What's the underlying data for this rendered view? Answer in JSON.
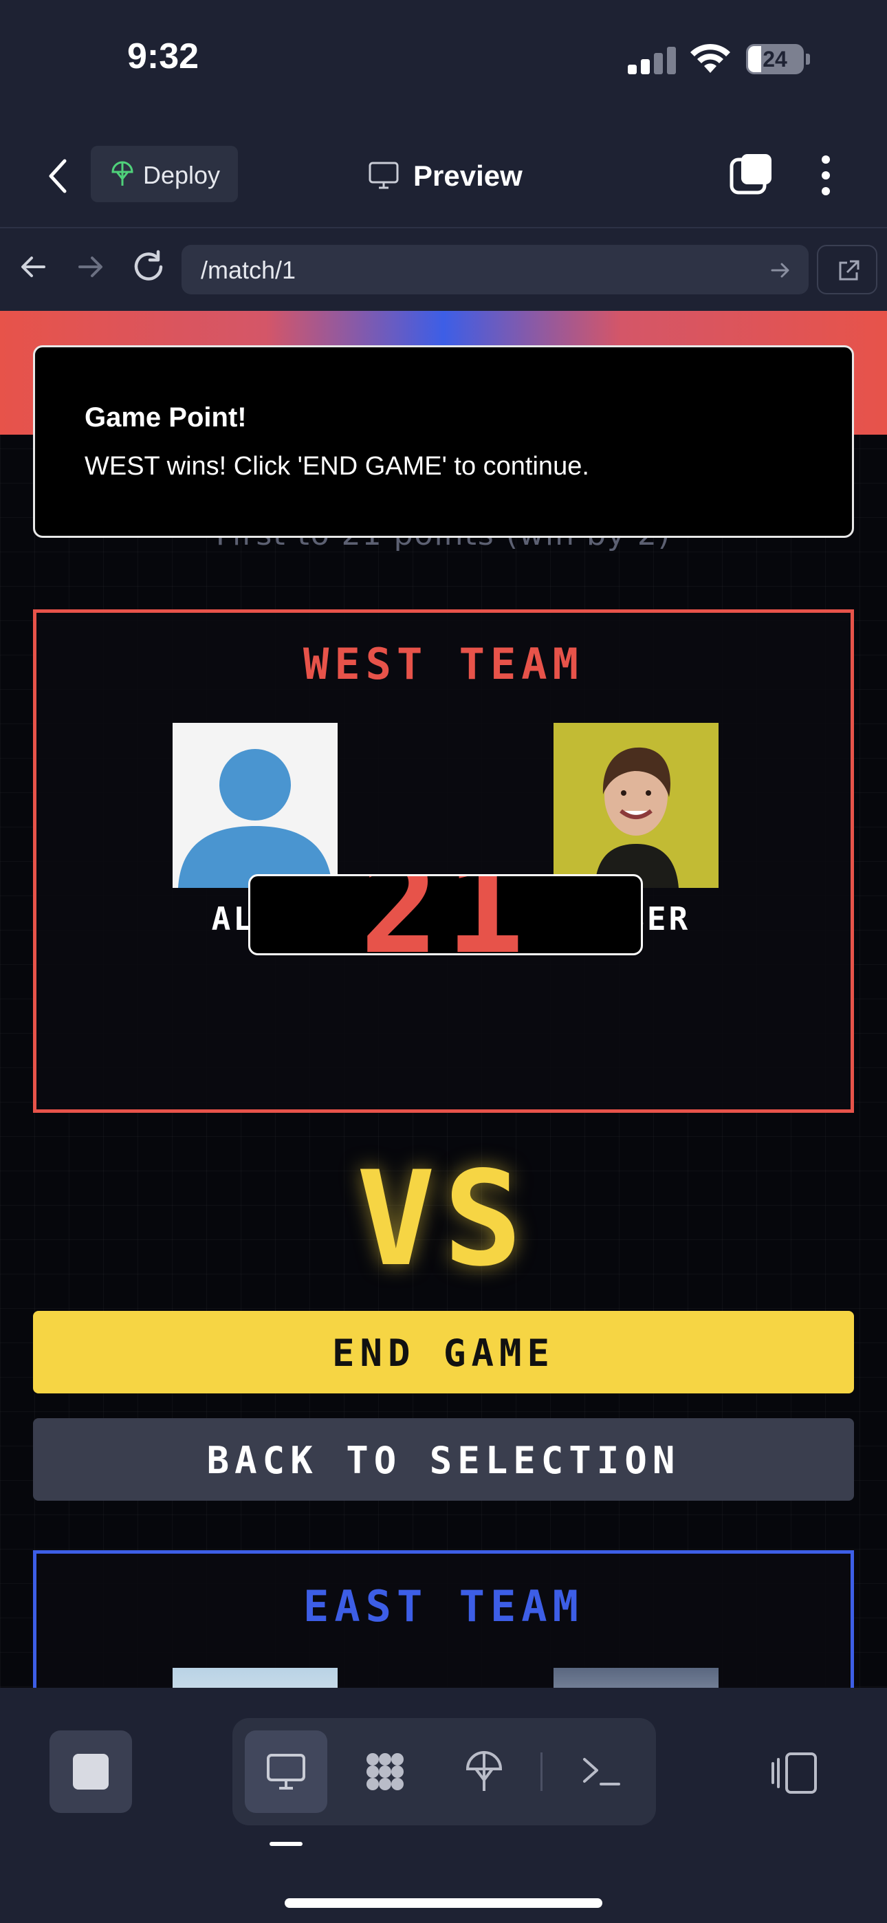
{
  "status_bar": {
    "time": "9:32",
    "battery": "24"
  },
  "header": {
    "deploy_label": "Deploy",
    "preview_label": "Preview"
  },
  "url_bar": {
    "url": "/match/1"
  },
  "match": {
    "rules_text": "First to 21 points (win by 2)",
    "west": {
      "title": "WEST TEAM",
      "color": "#e7534a",
      "players": [
        {
          "name": "ALEX"
        },
        {
          "name": "AMBER"
        }
      ],
      "score": "21"
    },
    "vs_label": "VS",
    "end_game_label": "END GAME",
    "back_label": "BACK TO SELECTION",
    "east": {
      "title": "EAST TEAM",
      "color": "#3d5ee6"
    }
  },
  "toast": {
    "title": "Game Point!",
    "message": "WEST wins! Click 'END GAME' to continue."
  },
  "colors": {
    "accent_yellow": "#f6d544",
    "background": "#06070c",
    "chrome": "#1e2233"
  },
  "icons": [
    "back-chevron-icon",
    "deploy-icon",
    "monitor-icon",
    "tabs-icon",
    "more-icon",
    "arrow-left-icon",
    "arrow-right-icon",
    "reload-icon",
    "external-link-icon",
    "stop-icon",
    "preview-icon",
    "apps-icon",
    "deploy-icon",
    "terminal-icon",
    "side-panel-icon"
  ]
}
